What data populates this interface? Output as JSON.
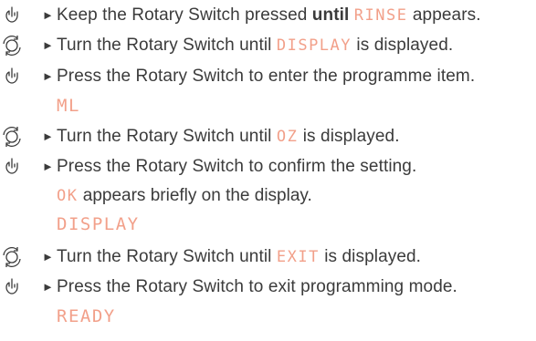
{
  "steps": [
    {
      "icon": "press-icon",
      "pre": "Keep the Rotary Switch pressed ",
      "bold": "until",
      "lcd": "RINSE",
      "post": " appears."
    },
    {
      "icon": "turn-icon",
      "pre": "Turn the Rotary Switch until ",
      "lcd": "DISPLAY",
      "post": " is displayed."
    },
    {
      "icon": "press-icon",
      "pre": "Press the Rotary Switch to enter the programme item."
    },
    {
      "lcd_line": "ML"
    },
    {
      "icon": "turn-icon",
      "pre": "Turn the Rotary Switch until ",
      "lcd": "OZ",
      "post": " is displayed."
    },
    {
      "icon": "press-icon",
      "pre": "Press the Rotary Switch to confirm the setting."
    },
    {
      "lcd": "OK",
      "post": " appears briefly on the display."
    },
    {
      "lcd_line": "DISPLAY"
    },
    {
      "icon": "turn-icon",
      "pre": "Turn the Rotary Switch until ",
      "lcd": "EXIT",
      "post": " is displayed."
    },
    {
      "icon": "press-icon",
      "pre": "Press the Rotary Switch to exit programming mode."
    },
    {
      "lcd_line": "READY"
    }
  ],
  "arrow": "►",
  "colors": {
    "lcd": "#f2a08a",
    "text": "#3b3b3b"
  }
}
